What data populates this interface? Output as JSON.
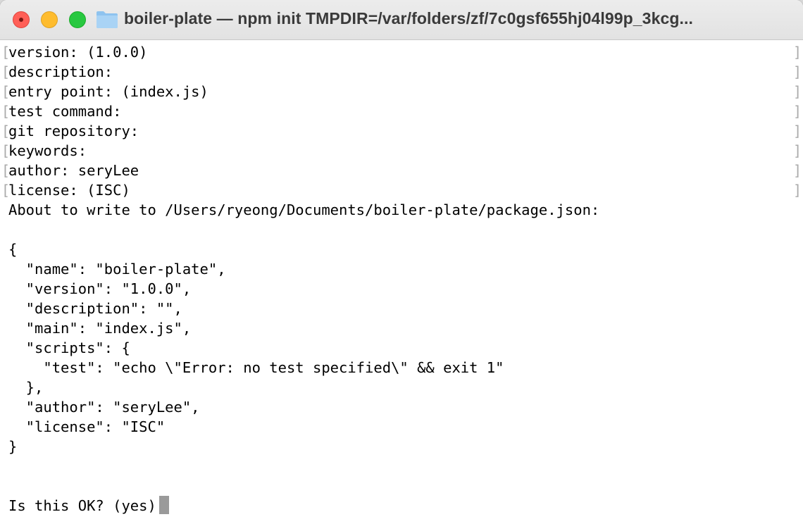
{
  "window": {
    "title": "boiler-plate — npm init TMPDIR=/var/folders/zf/7c0gsf655hj04l99p_3kcg..."
  },
  "terminal": {
    "prompted_lines": [
      "version: (1.0.0)",
      "description:",
      "entry point: (index.js)",
      "test command:",
      "git repository:",
      "keywords:",
      "author: seryLee",
      "license: (ISC)"
    ],
    "about_line": "About to write to /Users/ryeong/Documents/boiler-plate/package.json:",
    "json_lines": [
      "{",
      "  \"name\": \"boiler-plate\",",
      "  \"version\": \"1.0.0\",",
      "  \"description\": \"\",",
      "  \"main\": \"index.js\",",
      "  \"scripts\": {",
      "    \"test\": \"echo \\\"Error: no test specified\\\" && exit 1\"",
      "  },",
      "  \"author\": \"seryLee\",",
      "  \"license\": \"ISC\"",
      "}"
    ],
    "prompt": "Is this OK? (yes)"
  },
  "colors": {
    "close": "#ff5f57",
    "minimize": "#febc2e",
    "maximize": "#28c840",
    "cursor": "#9a9a9a"
  },
  "icons": {
    "folder": "folder-icon"
  }
}
